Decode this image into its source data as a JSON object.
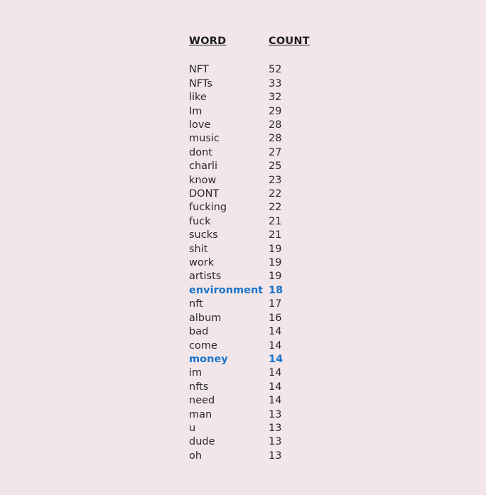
{
  "document": {
    "background_color": "#f2e6ea",
    "text_color": "#2a2a2a",
    "header_color": "#1d1d1d",
    "highlight_color": "#1a73c8"
  },
  "table": {
    "columns": [
      {
        "key": "word",
        "label": "WORD"
      },
      {
        "key": "count",
        "label": "COUNT"
      }
    ],
    "rows": [
      {
        "word": "NFT",
        "count": "52",
        "highlight": false
      },
      {
        "word": "NFTs",
        "count": "33",
        "highlight": false
      },
      {
        "word": "like",
        "count": "32",
        "highlight": false
      },
      {
        "word": "Im",
        "count": "29",
        "highlight": false
      },
      {
        "word": "love",
        "count": "28",
        "highlight": false
      },
      {
        "word": "music",
        "count": "28",
        "highlight": false
      },
      {
        "word": "dont",
        "count": "27",
        "highlight": false
      },
      {
        "word": "charli",
        "count": "25",
        "highlight": false
      },
      {
        "word": "know",
        "count": "23",
        "highlight": false
      },
      {
        "word": "DONT",
        "count": "22",
        "highlight": false
      },
      {
        "word": "fucking",
        "count": "22",
        "highlight": false
      },
      {
        "word": "fuck",
        "count": "21",
        "highlight": false
      },
      {
        "word": "sucks",
        "count": "21",
        "highlight": false
      },
      {
        "word": "shit",
        "count": "19",
        "highlight": false
      },
      {
        "word": "work",
        "count": "19",
        "highlight": false
      },
      {
        "word": "artists",
        "count": "19",
        "highlight": false
      },
      {
        "word": "environment",
        "count": "18",
        "highlight": true
      },
      {
        "word": "nft",
        "count": "17",
        "highlight": false
      },
      {
        "word": "album",
        "count": "16",
        "highlight": false
      },
      {
        "word": "bad",
        "count": "14",
        "highlight": false
      },
      {
        "word": "come",
        "count": "14",
        "highlight": false
      },
      {
        "word": "money",
        "count": "14",
        "highlight": true
      },
      {
        "word": "im",
        "count": "14",
        "highlight": false
      },
      {
        "word": "nfts",
        "count": "14",
        "highlight": false
      },
      {
        "word": "need",
        "count": "14",
        "highlight": false
      },
      {
        "word": "man",
        "count": "13",
        "highlight": false
      },
      {
        "word": "u",
        "count": "13",
        "highlight": false
      },
      {
        "word": "dude",
        "count": "13",
        "highlight": false
      },
      {
        "word": "oh",
        "count": "13",
        "highlight": false
      }
    ]
  }
}
